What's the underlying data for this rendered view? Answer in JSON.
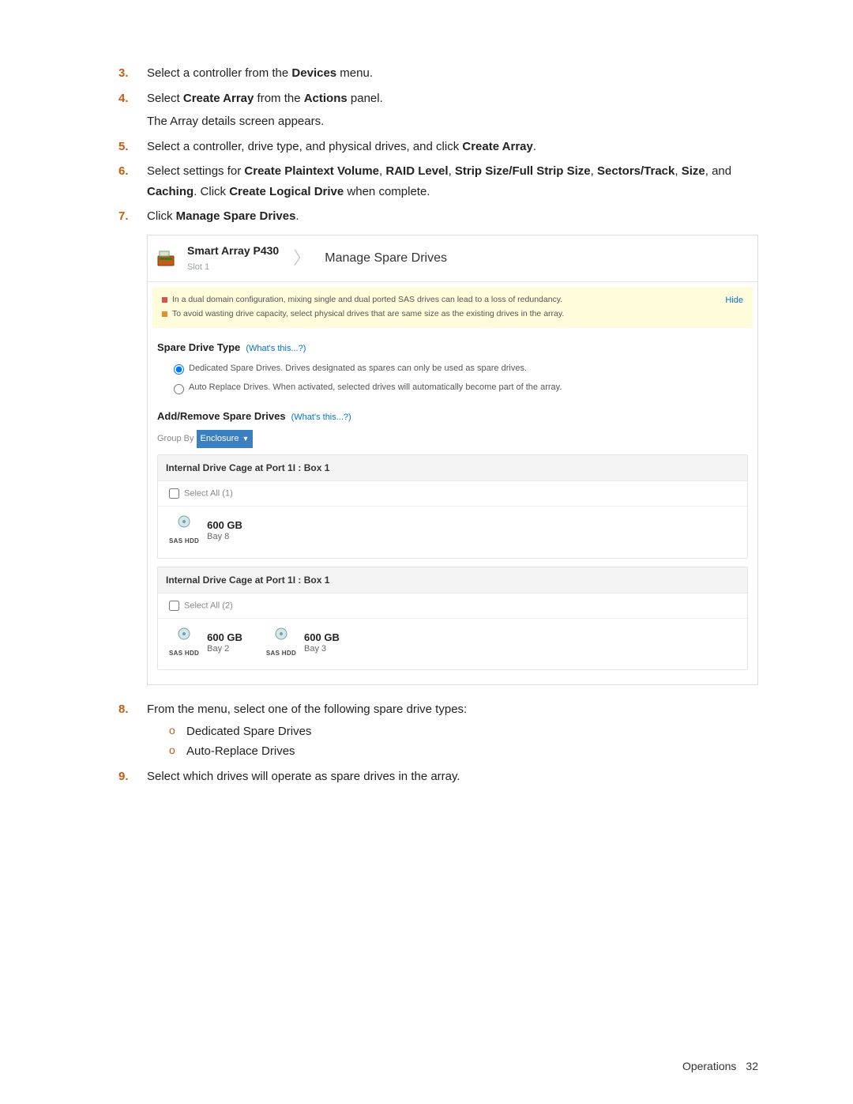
{
  "steps": {
    "s3": {
      "num": "3.",
      "parts": [
        "Select a controller from the ",
        "Devices",
        " menu."
      ]
    },
    "s4": {
      "num": "4.",
      "line1": [
        "Select ",
        "Create Array",
        " from the ",
        "Actions",
        " panel."
      ],
      "line2": "The Array details screen appears."
    },
    "s5": {
      "num": "5.",
      "parts": [
        "Select a controller, drive type, and physical drives, and click ",
        "Create Array",
        "."
      ]
    },
    "s6": {
      "num": "6.",
      "parts": [
        "Select settings for ",
        "Create Plaintext Volume",
        ", ",
        "RAID Level",
        ", ",
        "Strip Size/Full Strip Size",
        ", ",
        "Sectors/Track",
        ", ",
        "Size",
        ", and ",
        "Caching",
        ". Click ",
        "Create Logical Drive",
        " when complete."
      ]
    },
    "s7": {
      "num": "7.",
      "parts": [
        "Click ",
        "Manage Spare Drives",
        "."
      ]
    },
    "s8": {
      "num": "8.",
      "text": "From the menu, select one of the following spare drive types:",
      "bullet_marker": "o",
      "sub": [
        "Dedicated Spare Drives",
        "Auto-Replace Drives"
      ]
    },
    "s9": {
      "num": "9.",
      "text": "Select which drives will operate as spare drives in the array."
    }
  },
  "mock": {
    "breadcrumb": {
      "product": "Smart Array P430",
      "slot": "Slot 1",
      "page": "Manage Spare Drives"
    },
    "notice": {
      "line1": "In a dual domain configuration, mixing single and dual ported SAS drives can lead to a loss of redundancy.",
      "line2": "To avoid wasting drive capacity, select physical drives that are same size as the existing drives in the array.",
      "hide": "Hide"
    },
    "spare_type": {
      "heading": "Spare Drive Type",
      "whats": "(What's this...?)",
      "opt1": "Dedicated Spare Drives. Drives designated as spares can only be used as spare drives.",
      "opt2": "Auto Replace Drives. When activated, selected drives will automatically become part of the array."
    },
    "add_remove": {
      "heading": "Add/Remove Spare Drives",
      "whats": "(What's this...?)",
      "group_by_label": "Group By",
      "group_by_value": "Enclosure"
    },
    "enclosures": [
      {
        "title": "Internal Drive Cage at Port 1I : Box 1",
        "select_all": "Select All (1)",
        "drives": [
          {
            "size": "600 GB",
            "bay": "Bay 8",
            "kind": "SAS HDD"
          }
        ]
      },
      {
        "title": "Internal Drive Cage at Port 1I : Box 1",
        "select_all": "Select All (2)",
        "drives": [
          {
            "size": "600 GB",
            "bay": "Bay 2",
            "kind": "SAS HDD"
          },
          {
            "size": "600 GB",
            "bay": "Bay 3",
            "kind": "SAS HDD"
          }
        ]
      }
    ]
  },
  "footer": {
    "section": "Operations",
    "page": "32"
  }
}
